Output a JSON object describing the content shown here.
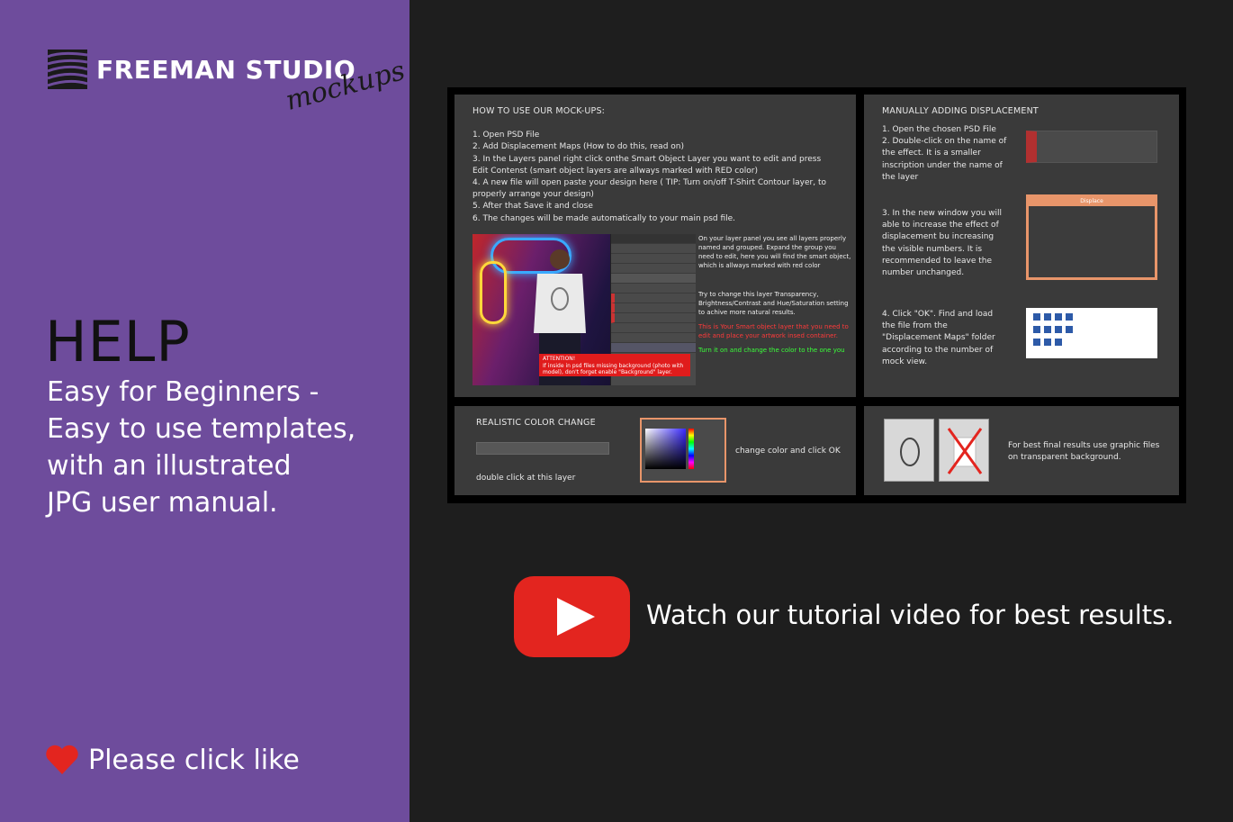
{
  "brand": {
    "name": "FREEMAN STUDIO",
    "script": "mockups"
  },
  "left": {
    "help_title": "HELP",
    "subtitle_lines": [
      "Easy for Beginners -",
      "Easy to use templates,",
      "with an illustrated",
      "JPG user manual."
    ],
    "like_text": "Please click like"
  },
  "manual": {
    "howto": {
      "title": "HOW TO USE OUR MOCK-UPS:",
      "steps": [
        "1.  Open PSD File",
        "2.  Add Displacement Maps (How to do this, read on)",
        "3.  In the Layers panel right click onthe Smart Object Layer you want to edit and press Edit Contenst (smart object layers are allways marked with RED color)",
        "4.  A new file will open paste your design here ( TIP: Turn on/off T-Shirt Contour layer, to properly arrange your design)",
        "5.  After that Save it and close",
        "6.  The changes will be made automatically to your main psd file."
      ],
      "note1": "On your layer panel you see all layers properly named and grouped. Expand the group you need to edit, here you will find the smart object, which is allways marked with red color",
      "note2": "Try to change this layer Transparency, Brightness/Contrast and Hue/Saturation setting to achive more natural results.",
      "note_red": "This is Your Smart object layer that you need to edit and place your artwork insed container.",
      "note_green": "Turn it on and change the color to the one you",
      "attention_title": "ATTENTION!",
      "attention_text": "If inside in psd files missing background (photo with model), don't forget enable \"Background\" layer."
    },
    "displacement": {
      "title": "MANUALLY ADDING DISPLACEMENT",
      "step1": "1. Open the chosen PSD File\n2. Double-click on the name of the effect. It is a smaller inscription under the name of the layer",
      "step3": "3. In the new window you will able to increase the effect of displacement bu increasing the visible numbers. It is recommended to leave the number unchanged.",
      "step4": "4. Click \"OK\". Find and load the file from the \"Displacement Maps\" folder according to the number of mock view.",
      "dialog_title": "Displace"
    },
    "color": {
      "title": "REALISTIC  COLOR CHANGE",
      "caption": "double click at this layer",
      "action": "change color and click OK"
    },
    "transparent": {
      "text": "For best final results use graphic files on transparent background."
    }
  },
  "video": {
    "text": "Watch our tutorial video for best results."
  },
  "colors": {
    "purple": "#6e4c9c",
    "dark": "#1e1e1e",
    "panel": "#3a3a3a",
    "youtube_red": "#e3251f"
  }
}
